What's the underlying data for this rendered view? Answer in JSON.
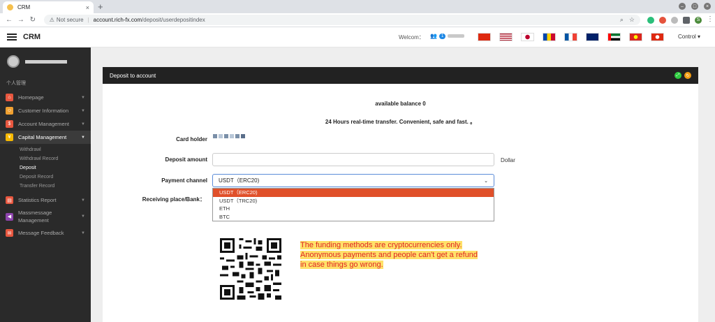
{
  "browser": {
    "tab_title": "CRM",
    "tab_close": "×",
    "new_tab": "+",
    "not_secure": "Not secure",
    "url_host": "account.rich-fx.com",
    "url_path": "/deposit/userdepositindex",
    "profile_initial": "S"
  },
  "header": {
    "brand": "CRM",
    "welcome": "Welcom：",
    "user_badge": "1",
    "control": "Control ▾",
    "flags": [
      "china",
      "usa",
      "japan",
      "moldova",
      "france",
      "new-zealand",
      "uae",
      "vietnam",
      "hong-kong"
    ]
  },
  "sidebar": {
    "section_title": "个人管理",
    "items": [
      {
        "label": "Homepage",
        "icon": "home-icon",
        "color": "#e8573f"
      },
      {
        "label": "Customer Information",
        "icon": "user-icon",
        "color": "#f0a030"
      },
      {
        "label": "Account Management",
        "icon": "account-icon",
        "color": "#e8573f"
      },
      {
        "label": "Capital Management",
        "icon": "yen-icon",
        "color": "#f5b800"
      },
      {
        "label": "Statistics Report",
        "icon": "chart-icon",
        "color": "#e8573f"
      },
      {
        "label": "Massmessage Management",
        "icon": "megaphone-icon",
        "color": "#8e44ad"
      },
      {
        "label": "Message Feedback",
        "icon": "feedback-icon",
        "color": "#e8573f"
      }
    ],
    "submenu": [
      "Withdrawl",
      "Withdrawl Record",
      "Deposit",
      "Deposit Record",
      "Transfer Record"
    ]
  },
  "panel": {
    "title": "Deposit to account",
    "balance": "available balance 0",
    "note": "24 Hours real-time transfer. Convenient, safe and fast. 。",
    "card_holder_label": "Card holder",
    "deposit_amount_label": "Deposit amount",
    "dollar": "Dollar",
    "payment_channel_label": "Payment channel",
    "payment_channel_value": "USDT（ERC20)",
    "receiving_label": "Receiving place/Bank：",
    "options": [
      "USDT（ERC20)",
      "USDT（TRC20)",
      "ETH",
      "BTC"
    ],
    "warning_line1": "The funding methods are cryptocurrencies only.",
    "warning_line2": "Anonymous payments and people can't get a refund",
    "warning_line3": "in case things go wrong."
  },
  "colors": {
    "accent": "#e0502a",
    "sidebar_bg": "#2a2a2a",
    "panel_header": "#222222",
    "warning_text": "#e02424",
    "warning_highlight": "#ffe169"
  }
}
